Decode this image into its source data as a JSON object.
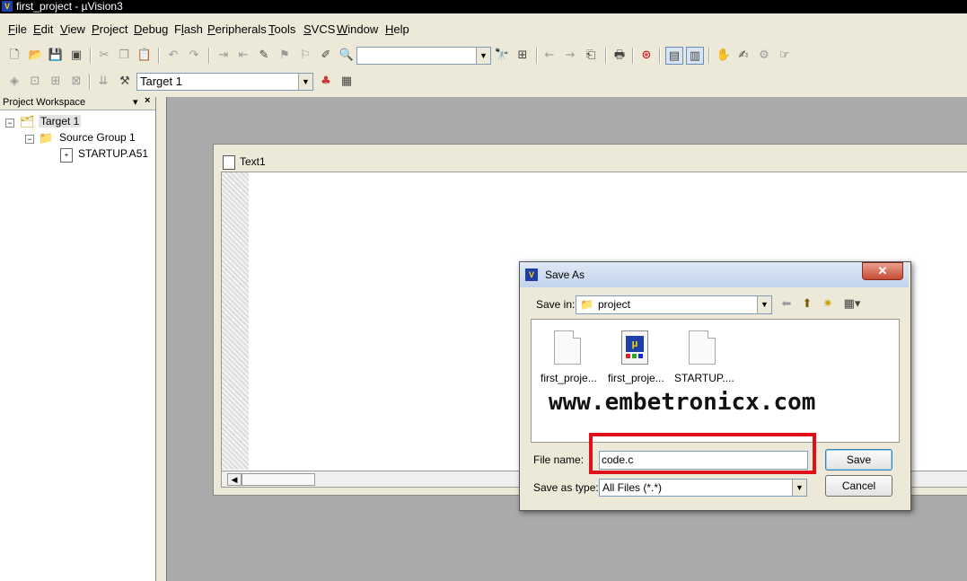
{
  "window": {
    "title": "first_project  - µVision3"
  },
  "menu": [
    {
      "label": "File",
      "u": "F",
      "rest": "ile"
    },
    {
      "label": "Edit",
      "u": "E",
      "rest": "dit"
    },
    {
      "label": "View",
      "u": "V",
      "rest": "iew"
    },
    {
      "label": "Project",
      "u": "P",
      "rest": "roject"
    },
    {
      "label": "Debug",
      "u": "D",
      "rest": "ebug"
    },
    {
      "label": "Flash",
      "u": "l",
      "pre": "F",
      "rest": "ash"
    },
    {
      "label": "Peripherals",
      "u": "P",
      "rest": "eripherals"
    },
    {
      "label": "Tools",
      "u": "T",
      "rest": "ools"
    },
    {
      "label": "SVCS",
      "u": "S",
      "rest": "VCS"
    },
    {
      "label": "Window",
      "u": "W",
      "rest": "indow"
    },
    {
      "label": "Help",
      "u": "H",
      "rest": "elp"
    }
  ],
  "toolbar": {
    "find_value": "",
    "target_value": "Target 1"
  },
  "workspace": {
    "title": "Project Workspace",
    "close_glyph": "×",
    "pin_glyph": "▾",
    "tree": {
      "target": "Target 1",
      "group": "Source Group 1",
      "file": "STARTUP.A51"
    }
  },
  "editor": {
    "title": "Text1"
  },
  "dialog": {
    "title": "Save As",
    "save_in_label": "Save in:",
    "save_in_value": "project",
    "files": [
      {
        "name": "first_proje...",
        "icon": "document-icon"
      },
      {
        "name": "first_proje...",
        "icon": "uvision-project-icon"
      },
      {
        "name": "STARTUP....",
        "icon": "document-icon"
      }
    ],
    "watermark": "www.embetronicx.com",
    "file_name_label": "File name:",
    "file_name_value": "code.c",
    "save_type_label": "Save as type:",
    "save_type_value": "All Files (*.*)",
    "save_button": "Save",
    "cancel_button": "Cancel",
    "highlight_color": "#e0101a"
  }
}
